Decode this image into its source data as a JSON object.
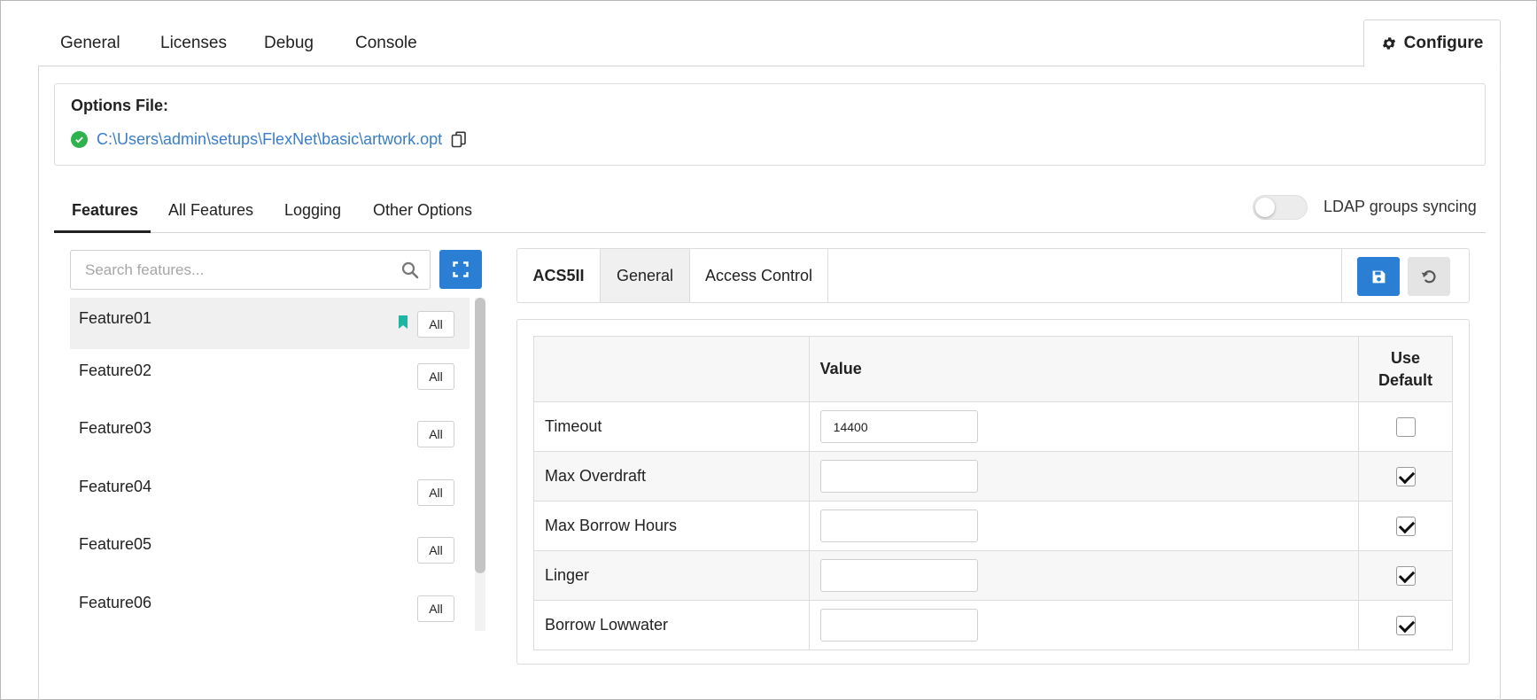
{
  "top_tabs": [
    "General",
    "Licenses",
    "Debug",
    "Console"
  ],
  "configure_tab": {
    "label": "Configure",
    "icon": "gear-icon"
  },
  "options_file": {
    "title": "Options File:",
    "path": "C:\\Users\\admin\\setups\\FlexNet\\basic\\artwork.opt",
    "status_icon": "check-circle-icon",
    "status_color": "#2eb24e"
  },
  "sub_tabs": [
    "Features",
    "All Features",
    "Logging",
    "Other Options"
  ],
  "active_sub_tab": "Features",
  "ldap": {
    "label": "LDAP groups syncing",
    "enabled": false
  },
  "search": {
    "placeholder": "Search features...",
    "value": ""
  },
  "features": [
    {
      "name": "Feature01",
      "badge": "All",
      "selected": true,
      "bookmarked": true
    },
    {
      "name": "Feature02",
      "badge": "All",
      "selected": false,
      "bookmarked": false
    },
    {
      "name": "Feature03",
      "badge": "All",
      "selected": false,
      "bookmarked": false
    },
    {
      "name": "Feature04",
      "badge": "All",
      "selected": false,
      "bookmarked": false
    },
    {
      "name": "Feature05",
      "badge": "All",
      "selected": false,
      "bookmarked": false
    },
    {
      "name": "Feature06",
      "badge": "All",
      "selected": false,
      "bookmarked": false
    }
  ],
  "detail": {
    "feature_name": "ACS5II",
    "tabs": [
      "General",
      "Access Control"
    ],
    "active_tab": "General"
  },
  "options_table": {
    "headers": [
      "",
      "Value",
      "Use\nDefault"
    ],
    "rows": [
      {
        "label": "Timeout",
        "value": "14400",
        "use_default": false
      },
      {
        "label": "Max Overdraft",
        "value": "",
        "use_default": true
      },
      {
        "label": "Max Borrow Hours",
        "value": "",
        "use_default": true
      },
      {
        "label": "Linger",
        "value": "",
        "use_default": true
      },
      {
        "label": "Borrow Lowwater",
        "value": "",
        "use_default": true
      }
    ]
  },
  "colors": {
    "accent": "#2a7fd4",
    "link": "#3a7dc9",
    "bookmark": "#1fb5a3"
  }
}
